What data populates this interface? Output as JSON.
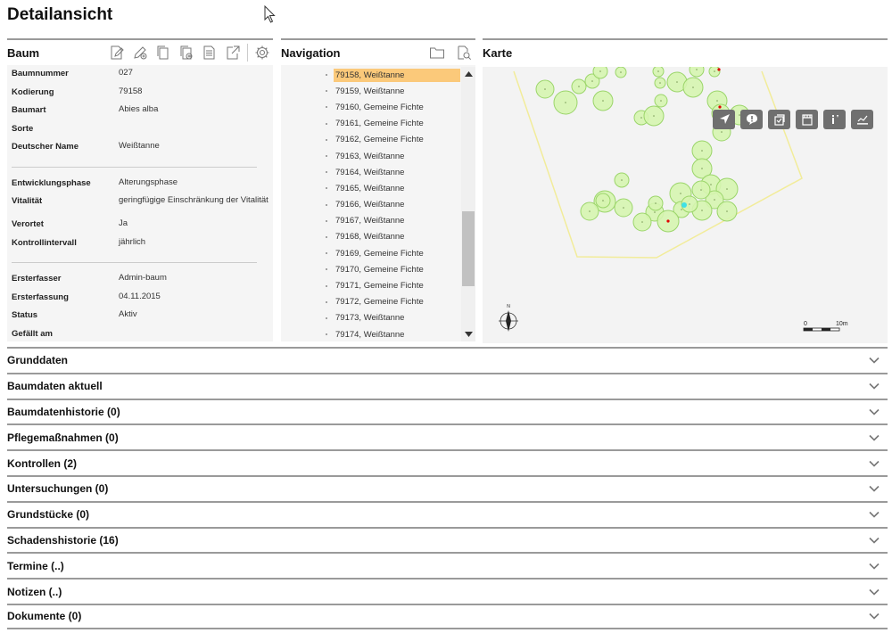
{
  "page": {
    "title": "Detailansicht"
  },
  "baum": {
    "title": "Baum",
    "tools": [
      "edit-document-icon",
      "edit-pen-add-icon",
      "copy-icon",
      "copy-add-icon",
      "report-icon",
      "export-icon",
      "settings-gear-icon"
    ],
    "fields": [
      {
        "label": "Baumnummer",
        "value": "027"
      },
      {
        "label": "Kodierung",
        "value": "79158"
      },
      {
        "label": "Baumart",
        "value": "Abies alba"
      },
      {
        "label": "Sorte",
        "value": ""
      },
      {
        "label": "Deutscher Name",
        "value": "Weißtanne"
      }
    ],
    "fields2": [
      {
        "label": "Entwicklungsphase",
        "value": "Alterungsphase"
      },
      {
        "label": "Vitalität",
        "value": "geringfügige Einschränkung der Vitalität"
      },
      {
        "label": "Verortet",
        "value": "Ja"
      },
      {
        "label": "Kontrollintervall",
        "value": "jährlich"
      }
    ],
    "fields3": [
      {
        "label": "Ersterfasser",
        "value": "Admin-baum"
      },
      {
        "label": "Ersterfassung",
        "value": "04.11.2015"
      },
      {
        "label": "Status",
        "value": "Aktiv"
      },
      {
        "label": "Gefällt am",
        "value": ""
      }
    ]
  },
  "navigation": {
    "title": "Navigation",
    "items": [
      "79158, Weißtanne",
      "79159, Weißtanne",
      "79160, Gemeine Fichte",
      "79161, Gemeine Fichte",
      "79162, Gemeine Fichte",
      "79163, Weißtanne",
      "79164, Weißtanne",
      "79165, Weißtanne",
      "79166, Weißtanne",
      "79167, Weißtanne",
      "79168, Weißtanne",
      "79169, Gemeine Fichte",
      "79170, Gemeine Fichte",
      "79171, Gemeine Fichte",
      "79172, Gemeine Fichte",
      "79173, Weißtanne",
      "79174, Weißtanne"
    ],
    "selected_index": 0
  },
  "karte": {
    "title": "Karte",
    "tools": [
      "navigate-arrow-icon",
      "alert-bubble-icon",
      "checkbox-layer-icon",
      "film-icon",
      "info-icon",
      "chart-icon"
    ],
    "north_label": "N",
    "scale_start": "0",
    "scale_end": "10m",
    "colors": {
      "tree_fill": "#d6f5b0",
      "tree_stroke": "#9bd56a",
      "boundary": "#f2ec9a",
      "marker_red": "#e00000",
      "marker_cyan": "#3ee0e6"
    }
  },
  "sections": [
    "Grunddaten",
    "Baumdaten aktuell",
    "Baumdatenhistorie (0)",
    "Pflegemaßnahmen (0)",
    "Kontrollen (2)",
    "Untersuchungen (0)",
    "Grundstücke (0)",
    "Schadenshistorie (16)",
    "Termine (..)",
    "Notizen (..)",
    "Dokumente (0)"
  ]
}
